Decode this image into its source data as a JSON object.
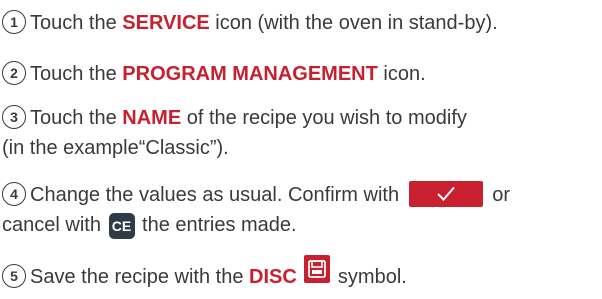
{
  "steps": [
    {
      "number": "1",
      "before": "Touch the ",
      "keyword": "SERVICE",
      "after": " icon (with the oven in stand-by)."
    },
    {
      "number": "2",
      "before": "Touch the ",
      "keyword": "PROGRAM MANAGEMENT",
      "after": " icon."
    },
    {
      "number": "3",
      "before": "Touch the ",
      "keyword": "NAME",
      "after": " of the recipe you wish to modify",
      "line2": "(in the example“Classic”)."
    },
    {
      "number": "4",
      "before": "Change the values as usual. Confirm with ",
      "after": " or",
      "line2_before": "cancel with ",
      "ce_label": "CE",
      "line2_after": " the entries made."
    },
    {
      "number": "5",
      "before": "Save the recipe with the ",
      "keyword": "DISC",
      "after": " symbol."
    }
  ],
  "colors": {
    "accent": "#c8202f",
    "ce_button": "#2f3b45",
    "text": "#3a3a3a"
  },
  "icons": {
    "confirm": "checkmark-icon",
    "save": "floppy-disk-icon"
  }
}
